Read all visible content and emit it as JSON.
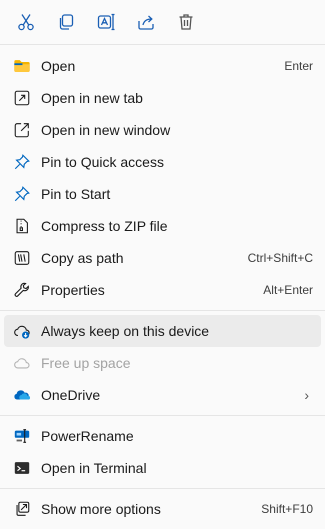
{
  "toolbar": {
    "cut_icon": "scissors-icon",
    "copy_icon": "copy-icon",
    "rename_icon": "rename-icon",
    "share_icon": "share-icon",
    "delete_icon": "trash-icon"
  },
  "items": {
    "open": {
      "label": "Open",
      "shortcut": "Enter",
      "icon": "folder-icon"
    },
    "open_new_tab": {
      "label": "Open in new tab",
      "icon": "new-tab-icon"
    },
    "open_new_window": {
      "label": "Open in new window",
      "icon": "new-window-icon"
    },
    "pin_quick": {
      "label": "Pin to Quick access",
      "icon": "pin-icon"
    },
    "pin_start": {
      "label": "Pin to Start",
      "icon": "pin-icon"
    },
    "compress": {
      "label": "Compress to ZIP file",
      "icon": "zip-icon"
    },
    "copy_path": {
      "label": "Copy as path",
      "shortcut": "Ctrl+Shift+C",
      "icon": "path-icon"
    },
    "properties": {
      "label": "Properties",
      "shortcut": "Alt+Enter",
      "icon": "wrench-icon"
    },
    "always_keep": {
      "label": "Always keep on this device",
      "icon": "cloud-download-icon"
    },
    "free_up": {
      "label": "Free up space",
      "icon": "cloud-icon"
    },
    "onedrive": {
      "label": "OneDrive",
      "chevron": "›",
      "icon": "onedrive-icon"
    },
    "powerrename": {
      "label": "PowerRename",
      "icon": "powerrename-icon"
    },
    "terminal": {
      "label": "Open in Terminal",
      "icon": "terminal-icon"
    },
    "more_options": {
      "label": "Show more options",
      "shortcut": "Shift+F10",
      "icon": "more-options-icon"
    }
  },
  "colors": {
    "accent": "#0067c0",
    "folder": "#f4b400",
    "highlight": "#ebebeb",
    "disabled": "#a3a3a3"
  }
}
